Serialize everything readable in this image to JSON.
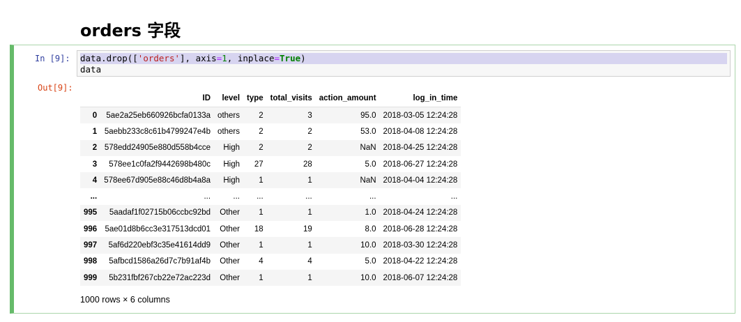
{
  "heading": "orders 字段",
  "cell": {
    "in_prompt": "In  [9]:",
    "out_prompt": "Out[9]:",
    "code": {
      "line1": {
        "p1": "data.drop([",
        "str": "'orders'",
        "p2": "], axis",
        "eq1": "=",
        "num": "1",
        "p3": ", inplace",
        "eq2": "=",
        "kw": "True",
        "p4": ")"
      },
      "line2": "data"
    }
  },
  "table": {
    "columns": [
      "",
      "ID",
      "level",
      "type",
      "total_visits",
      "action_amount",
      "log_in_time"
    ],
    "rows": [
      [
        "0",
        "5ae2a25eb660926bcfa0133a",
        "others",
        "2",
        "3",
        "95.0",
        "2018-03-05 12:24:28"
      ],
      [
        "1",
        "5aebb233c8c61b4799247e4b",
        "others",
        "2",
        "2",
        "53.0",
        "2018-04-08 12:24:28"
      ],
      [
        "2",
        "578edd24905e880d558b4cce",
        "High",
        "2",
        "2",
        "NaN",
        "2018-04-25 12:24:28"
      ],
      [
        "3",
        "578ee1c0fa2f9442698b480c",
        "High",
        "27",
        "28",
        "5.0",
        "2018-06-27 12:24:28"
      ],
      [
        "4",
        "578ee67d905e88c46d8b4a8a",
        "High",
        "1",
        "1",
        "NaN",
        "2018-04-04 12:24:28"
      ],
      [
        "...",
        "...",
        "...",
        "...",
        "...",
        "...",
        "..."
      ],
      [
        "995",
        "5aadaf1f02715b06ccbc92bd",
        "Other",
        "1",
        "1",
        "1.0",
        "2018-04-24 12:24:28"
      ],
      [
        "996",
        "5ae01d8b6cc3e317513dcd01",
        "Other",
        "18",
        "19",
        "8.0",
        "2018-06-28 12:24:28"
      ],
      [
        "997",
        "5af6d220ebf3c35e41614dd9",
        "Other",
        "1",
        "1",
        "10.0",
        "2018-03-30 12:24:28"
      ],
      [
        "998",
        "5afbcd1586a26d7c7b91af4b",
        "Other",
        "4",
        "4",
        "5.0",
        "2018-04-22 12:24:28"
      ],
      [
        "999",
        "5b231fbf267cb22e72ac223d",
        "Other",
        "1",
        "1",
        "10.0",
        "2018-06-07 12:24:28"
      ]
    ],
    "footer": "1000 rows × 6 columns"
  }
}
